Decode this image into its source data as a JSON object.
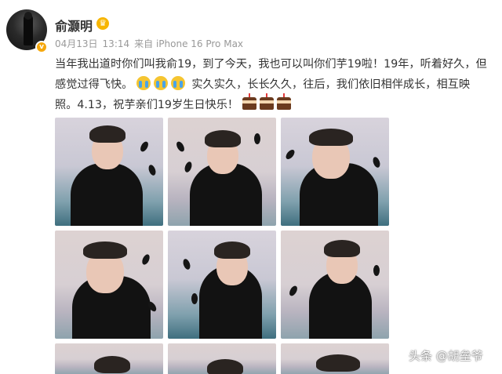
{
  "post": {
    "username": "俞灏明",
    "date": "04月13日",
    "time": "13:14",
    "source": "来自 iPhone 16 Pro Max",
    "text_line1": "当年我出道时你们叫我俞19，到了今天，我也可以叫你们芋19啦！19年，听着好久，但",
    "text_line2a": "感觉过得飞快。",
    "text_line2b": "实久实久，长长久久，往后，我们依旧相伴成长，相互映",
    "text_line3a": "照。4.13，祝芋亲们19岁生日快乐！"
  },
  "icons": {
    "verified": "verified-badge-icon",
    "vip": "vip-crown-icon",
    "emoji_cry": "crying-emoji-icon",
    "emoji_cake": "cake-emoji-icon"
  },
  "colors": {
    "name": "#333333",
    "meta": "#999999",
    "badge": "#f6a80d"
  },
  "watermark": "头条 @胡垒爷"
}
